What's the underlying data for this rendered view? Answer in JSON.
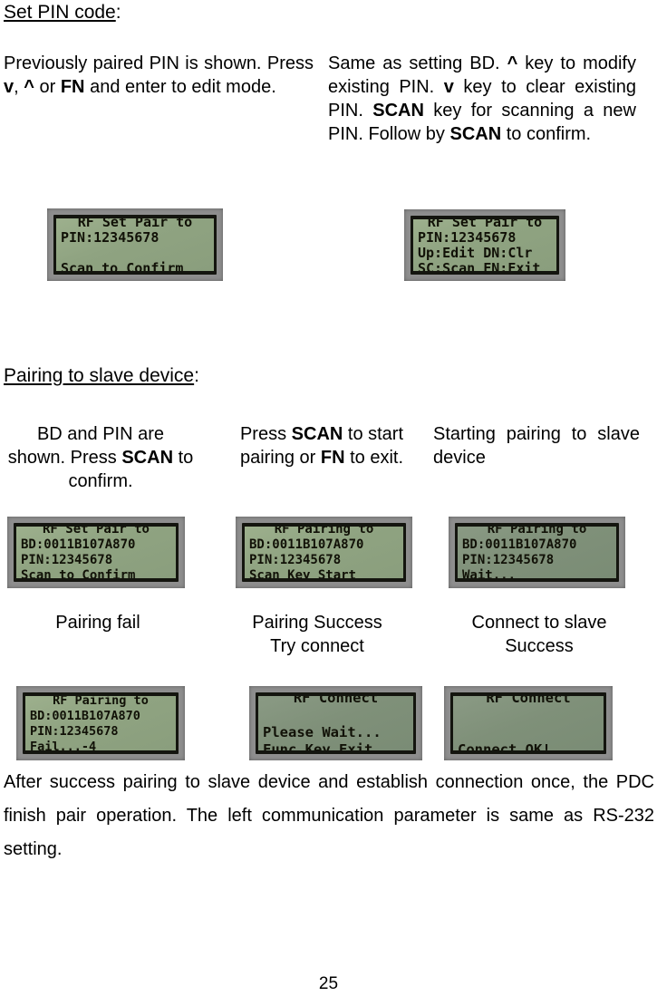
{
  "document": {
    "page_number": "25"
  },
  "sections": {
    "set_pin": {
      "heading": "Set PIN code",
      "heading_suffix": ":",
      "column_left": {
        "text_parts": [
          {
            "t": "Previously paired PIN is shown. Press ",
            "b": false
          },
          {
            "t": "v",
            "b": true
          },
          {
            "t": ", ",
            "b": false
          },
          {
            "t": "^",
            "b": true
          },
          {
            "t": " or ",
            "b": false
          },
          {
            "t": "FN",
            "b": true
          },
          {
            "t": " and enter to edit mode.",
            "b": false
          }
        ]
      },
      "column_right": {
        "text_parts": [
          {
            "t": "Same as setting BD. ",
            "b": false
          },
          {
            "t": "^",
            "b": true
          },
          {
            "t": " key to modify existing PIN. ",
            "b": false
          },
          {
            "t": "v",
            "b": true
          },
          {
            "t": " key to clear existing PIN. ",
            "b": false
          },
          {
            "t": "SCAN",
            "b": true
          },
          {
            "t": " key for scanning a new PIN. Follow by ",
            "b": false
          },
          {
            "t": "SCAN",
            "b": true
          },
          {
            "t": " to confirm.",
            "b": false
          }
        ]
      }
    },
    "pairing": {
      "heading": "Pairing to slave device",
      "heading_suffix": ":",
      "caption_1": {
        "text_parts": [
          {
            "t": "BD and PIN are shown. Press ",
            "b": false
          },
          {
            "t": "SCAN",
            "b": true
          },
          {
            "t": " to confirm.",
            "b": false
          }
        ]
      },
      "caption_2": {
        "text_parts": [
          {
            "t": "Press ",
            "b": false
          },
          {
            "t": "SCAN",
            "b": true
          },
          {
            "t": " to start pairing or ",
            "b": false
          },
          {
            "t": "FN",
            "b": true
          },
          {
            "t": " to exit.",
            "b": false
          }
        ]
      },
      "caption_3": {
        "text_parts": [
          {
            "t": "Starting pairing to slave device",
            "b": false
          }
        ]
      },
      "caption_row2_1": "Pairing fail",
      "caption_row2_2_line1": "Pairing Success",
      "caption_row2_2_line2": "Try connect",
      "caption_row2_3_line1": "Connect to slave",
      "caption_row2_3_line2": "Success"
    },
    "closing_paragraph": {
      "text_parts": [
        {
          "t": "After success pairing to slave device and establish connection once, the PDC finish pair operation. The left communication parameter is same as RS-232 setting.",
          "b": false
        }
      ]
    }
  },
  "lcd_screens": [
    {
      "id": "lcd-set-pair-confirm",
      "lines": [
        "RF Set Pair to",
        "PIN:12345678",
        "",
        "Scan to Confirm"
      ],
      "align": [
        "center",
        "left",
        "left",
        "left"
      ],
      "dim": false
    },
    {
      "id": "lcd-set-pair-menu",
      "lines": [
        "RF Set Pair to",
        "PIN:12345678",
        "Up:Edit DN:Clr",
        "SC:Scan FN:Exit"
      ],
      "align": [
        "center",
        "left",
        "left",
        "left"
      ],
      "dim": false
    },
    {
      "id": "lcd-slave-set-pair-confirm",
      "lines": [
        "RF Set Pair to",
        "BD:0011B107A870",
        "PIN:12345678",
        "Scan to Confirm"
      ],
      "align": [
        "center",
        "left",
        "left",
        "left"
      ],
      "dim": false
    },
    {
      "id": "lcd-slave-pairing-scan-start",
      "lines": [
        "RF Pairing to",
        "BD:0011B107A870",
        "PIN:12345678",
        "Scan Key Start"
      ],
      "align": [
        "center",
        "left",
        "left",
        "left"
      ],
      "dim": false
    },
    {
      "id": "lcd-slave-pairing-wait",
      "lines": [
        "RF Pairing to",
        "BD:0011B107A870",
        "PIN:12345678",
        "Wait..."
      ],
      "align": [
        "center",
        "left",
        "left",
        "left"
      ],
      "dim": true
    },
    {
      "id": "lcd-pairing-fail",
      "lines": [
        "RF Pairing to",
        "BD:0011B107A870",
        "PIN:12345678",
        "Fail...-4"
      ],
      "align": [
        "center",
        "left",
        "left",
        "left"
      ],
      "dim": false
    },
    {
      "id": "lcd-rf-connect-wait",
      "lines": [
        "RF Connect",
        "",
        "Please Wait...",
        "Func Key Exit"
      ],
      "align": [
        "center",
        "left",
        "left",
        "left"
      ],
      "dim": true
    },
    {
      "id": "lcd-rf-connect-ok",
      "lines": [
        "RF Connect",
        "",
        "",
        "Connect OK!"
      ],
      "align": [
        "center",
        "left",
        "left",
        "left"
      ],
      "dim": true
    }
  ],
  "colors": {
    "lcd_background": "#93a885",
    "lcd_background_dim": "#7f9079",
    "lcd_text": "#111107",
    "lcd_bezel": "#14150f",
    "photo_frame": "#8e8e8e",
    "page_background": "#ffffff",
    "body_text": "#000000"
  }
}
